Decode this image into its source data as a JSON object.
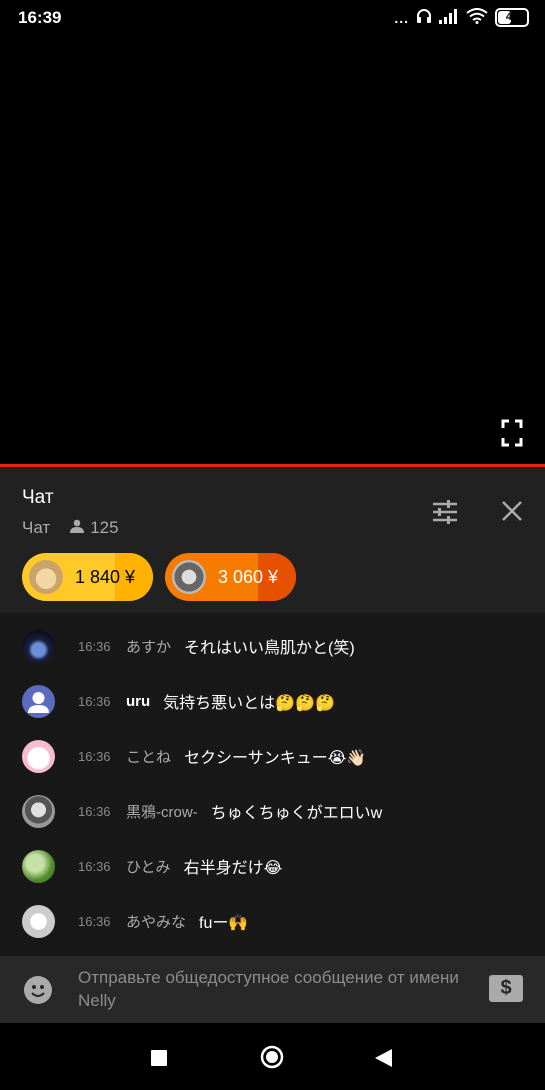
{
  "status_bar": {
    "time": "16:39",
    "dots": "...",
    "battery": "42"
  },
  "video": {
    "fullscreen_icon": "fullscreen-icon"
  },
  "chat": {
    "title": "Чат",
    "mode": "Чат",
    "viewer_count": "125",
    "settings_icon": "sliders-icon",
    "close_icon": "close-icon"
  },
  "superchats": [
    {
      "amount": "1 840 ¥",
      "color": "#ffca28"
    },
    {
      "amount": "3 060 ¥",
      "color": "#f57c00"
    }
  ],
  "messages": [
    {
      "time": "16:36",
      "author": "あすか",
      "text": "それはいい鳥肌かと(笑)"
    },
    {
      "time": "16:36",
      "author": "uru",
      "text": "気持ち悪いとは🤔🤔🤔"
    },
    {
      "time": "16:36",
      "author": "ことね",
      "text": "セクシーサンキュー😭👋🏻"
    },
    {
      "time": "16:36",
      "author": "黒鴉-crow-",
      "text": "ちゅくちゅくがエロいw"
    },
    {
      "time": "16:36",
      "author": "ひとみ",
      "text": "右半身だけ😂"
    },
    {
      "time": "16:36",
      "author": "あやみな",
      "text": "fuー🙌"
    }
  ],
  "input": {
    "placeholder": "Отправьте общедоступное сообщение от имени Nelly",
    "superchat_symbol": "$"
  }
}
